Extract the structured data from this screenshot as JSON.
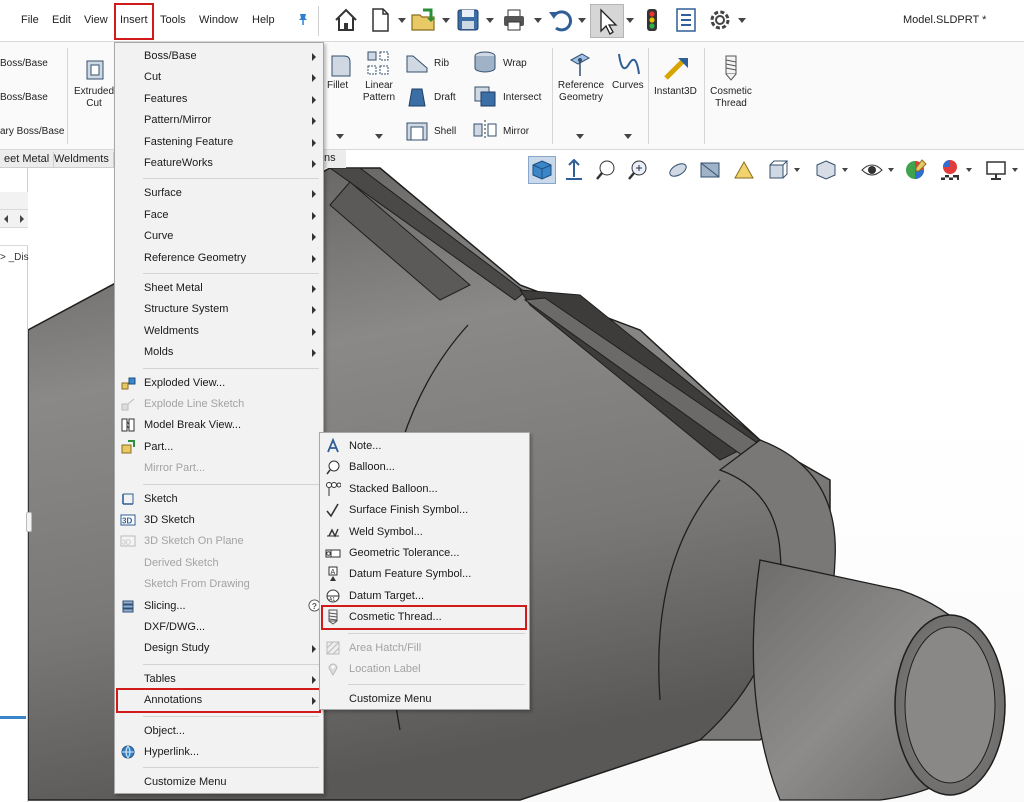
{
  "menubar": {
    "items": [
      "File",
      "Edit",
      "View",
      "Insert",
      "Tools",
      "Window",
      "Help"
    ],
    "doc_title": "Model.SLDPRT *"
  },
  "quick_access": [
    "home-icon",
    "new-document-icon",
    "open-folder-icon",
    "save-icon",
    "print-icon",
    "undo-icon",
    "select-arrow-icon",
    "rebuild-traffic-light-icon",
    "file-properties-icon",
    "options-gear-icon"
  ],
  "ribbon": {
    "left_labels": [
      "Boss/Base",
      "Boss/Base",
      "ary Boss/Base"
    ],
    "extruded_cut": "Extruded Cut",
    "fillet": "Fillet",
    "linear_pattern": "Linear Pattern",
    "rib": "Rib",
    "draft": "Draft",
    "shell": "Shell",
    "wrap": "Wrap",
    "intersect": "Intersect",
    "mirror": "Mirror",
    "reference_geometry": "Reference Geometry",
    "curves": "Curves",
    "instant3d": "Instant3D",
    "cosmetic_thread": "Cosmetic Thread"
  },
  "tabs": [
    "eet Metal",
    "Weldments"
  ],
  "tab_tail": "ns",
  "tree_stub_text": "> _Dis",
  "insert_menu": {
    "groups": [
      [
        {
          "label": "Boss/Base",
          "submenu": true
        },
        {
          "label": "Cut",
          "submenu": true
        },
        {
          "label": "Features",
          "submenu": true
        },
        {
          "label": "Pattern/Mirror",
          "submenu": true
        },
        {
          "label": "Fastening Feature",
          "submenu": true
        },
        {
          "label": "FeatureWorks",
          "submenu": true
        }
      ],
      [
        {
          "label": "Surface",
          "submenu": true
        },
        {
          "label": "Face",
          "submenu": true
        },
        {
          "label": "Curve",
          "submenu": true
        },
        {
          "label": "Reference Geometry",
          "submenu": true
        }
      ],
      [
        {
          "label": "Sheet Metal",
          "submenu": true
        },
        {
          "label": "Structure System",
          "submenu": true
        },
        {
          "label": "Weldments",
          "submenu": true
        },
        {
          "label": "Molds",
          "submenu": true
        }
      ],
      [
        {
          "label": "Exploded View...",
          "icon": "exploded-view-icon"
        },
        {
          "label": "Explode Line Sketch",
          "icon": "explode-line-sketch-icon",
          "disabled": true
        },
        {
          "label": "Model Break View...",
          "icon": "model-break-view-icon"
        },
        {
          "label": "Part...",
          "icon": "insert-part-icon"
        },
        {
          "label": "Mirror Part...",
          "disabled": true
        }
      ],
      [
        {
          "label": "Sketch",
          "icon": "sketch-icon"
        },
        {
          "label": "3D Sketch",
          "icon": "3d-sketch-icon"
        },
        {
          "label": "3D Sketch On Plane",
          "icon": "3d-sketch-on-plane-icon",
          "disabled": true
        },
        {
          "label": "Derived Sketch",
          "disabled": true
        },
        {
          "label": "Sketch From Drawing",
          "disabled": true
        },
        {
          "label": "Slicing...",
          "icon": "slicing-icon",
          "help": true
        },
        {
          "label": "DXF/DWG..."
        },
        {
          "label": "Design Study",
          "submenu": true
        }
      ],
      [
        {
          "label": "Tables",
          "submenu": true
        },
        {
          "label": "Annotations",
          "submenu": true,
          "highlighted": true
        }
      ],
      [
        {
          "label": "Object..."
        },
        {
          "label": "Hyperlink...",
          "icon": "hyperlink-globe-icon"
        }
      ],
      [
        {
          "label": "Customize Menu"
        }
      ]
    ]
  },
  "annotations_menu": {
    "groups": [
      [
        {
          "label": "Note...",
          "icon": "note-icon"
        },
        {
          "label": "Balloon...",
          "icon": "balloon-icon"
        },
        {
          "label": "Stacked Balloon...",
          "icon": "stacked-balloon-icon"
        },
        {
          "label": "Surface Finish Symbol...",
          "icon": "surface-finish-icon"
        },
        {
          "label": "Weld Symbol...",
          "icon": "weld-symbol-icon"
        },
        {
          "label": "Geometric Tolerance...",
          "icon": "geometric-tolerance-icon"
        },
        {
          "label": "Datum Feature Symbol...",
          "icon": "datum-feature-icon"
        },
        {
          "label": "Datum Target...",
          "icon": "datum-target-icon"
        },
        {
          "label": "Cosmetic Thread...",
          "icon": "cosmetic-thread-icon",
          "highlighted": true
        }
      ],
      [
        {
          "label": "Area Hatch/Fill",
          "icon": "area-hatch-icon",
          "disabled": true
        },
        {
          "label": "Location Label",
          "icon": "location-label-icon",
          "disabled": true
        }
      ],
      [
        {
          "label": "Customize Menu"
        }
      ]
    ]
  },
  "colors": {
    "highlight_red": "#d11a1a",
    "menu_bg": "#f2f2f2",
    "part_gray": "#7d7b79"
  }
}
